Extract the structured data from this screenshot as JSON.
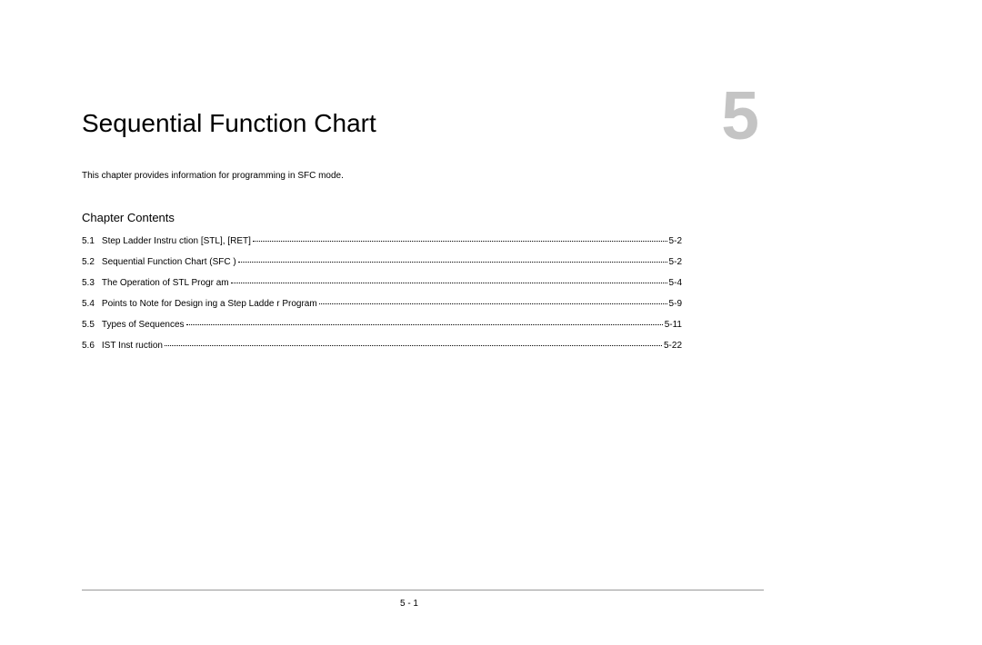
{
  "chapter": {
    "title": "Sequential Function Chart",
    "number": "5",
    "description": "This chapter provides information for programming in SFC mode."
  },
  "contents": {
    "heading": "Chapter Contents",
    "entries": [
      {
        "num": "5.1",
        "title": "Step Ladder Instru ction [STL],  [RET]",
        "page": "5-2"
      },
      {
        "num": "5.2",
        "title": "Sequential Function   Chart (SFC )",
        "page": "5-2"
      },
      {
        "num": "5.3",
        "title": "The Operation of  STL Progr am",
        "page": "5-4"
      },
      {
        "num": "5.4",
        "title": "Points to Note for Design   ing a Step Ladde r Program",
        "page": "5-9"
      },
      {
        "num": "5.5",
        "title": "Types of  Sequences",
        "page": " 5-11"
      },
      {
        "num": "5.6",
        "title": "IST Inst ruction",
        "page": "5-22"
      }
    ]
  },
  "footer": {
    "pageNumber": "5 - 1"
  }
}
